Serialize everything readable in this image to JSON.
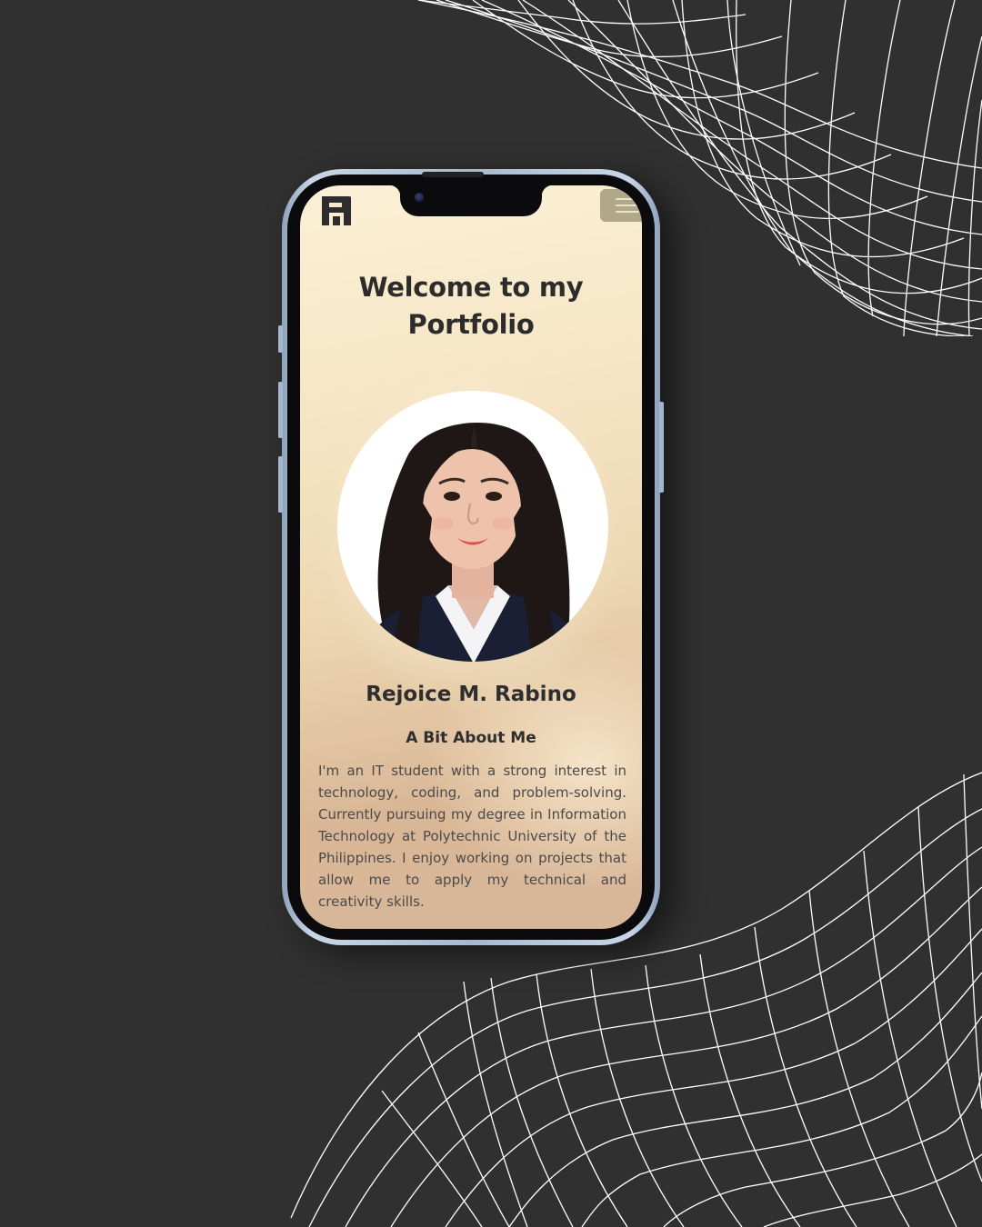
{
  "page": {
    "title": "Welcome to my Portfolio",
    "name": "Rejoice M. Rabino",
    "about_heading": "A Bit About Me",
    "about_text": "I'm an IT student with a strong interest in technology, coding, and problem-solving. Currently pursuing my degree in Information Technology at Polytechnic University of the Philippines. I enjoy working on projects that allow me to apply my technical and creativity skills."
  },
  "header": {
    "logo_icon": "letter-r-logo-icon",
    "menu_icon": "hamburger-menu-icon"
  },
  "colors": {
    "background": "#303030",
    "heading_text": "#2c2c2c",
    "body_text": "#4a4a4a",
    "menu_button": "#b1a88a",
    "phone_frame": "#a8b8cf",
    "screen_gradient_top": "#fbf0d6",
    "screen_gradient_bottom": "#d8b699"
  }
}
